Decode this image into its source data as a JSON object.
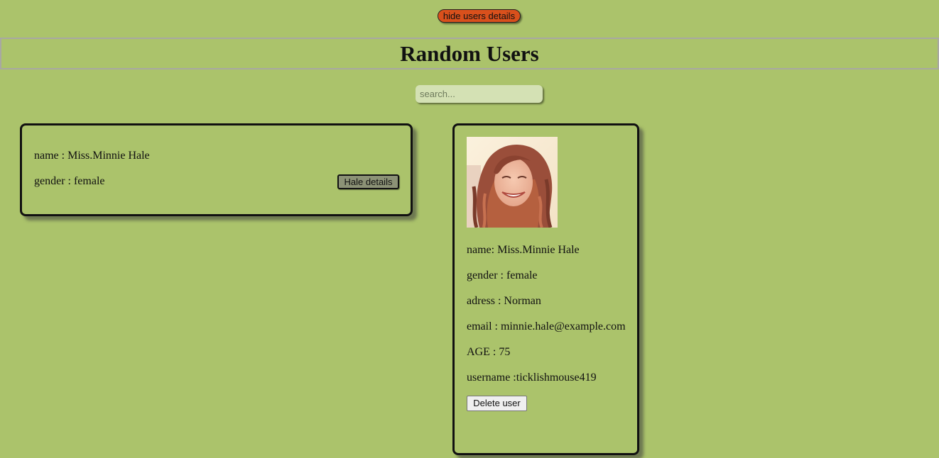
{
  "header": {
    "toggle_label": "hide users details",
    "title": "Random Users"
  },
  "search": {
    "placeholder": "search...",
    "value": ""
  },
  "summary_card": {
    "name_line": "name : Miss.Minnie Hale",
    "gender_line": "gender : female",
    "details_button": "Hale details"
  },
  "detail_card": {
    "avatar_icon": "user-photo",
    "name_line": "name: Miss.Minnie Hale",
    "gender_line": "gender : female",
    "address_line": "adress : Norman",
    "email_line": "email : minnie.hale@example.com",
    "age_line": "AGE : 75",
    "username_line": "username :ticklishmouse419",
    "delete_button": "Delete user"
  },
  "colors": {
    "background": "#abc36b",
    "toggle_button": "#d9501c",
    "details_button": "#8c9276",
    "search_field": "#d4e1b4"
  }
}
